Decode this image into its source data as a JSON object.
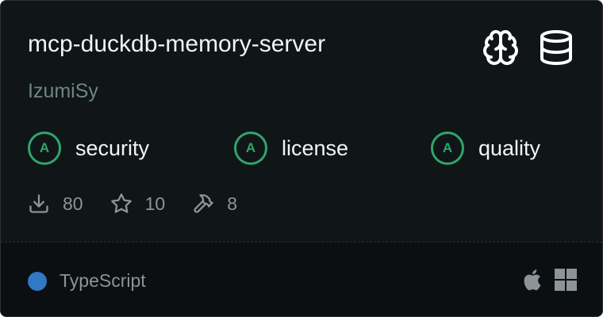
{
  "server": {
    "name": "mcp-duckdb-memory-server",
    "author": "IzumiSy"
  },
  "category_icons": [
    "brain-icon",
    "database-icon"
  ],
  "scores": [
    {
      "grade": "A",
      "label": "security"
    },
    {
      "grade": "A",
      "label": "license"
    },
    {
      "grade": "A",
      "label": "quality"
    }
  ],
  "stats": {
    "downloads": "80",
    "stars": "10",
    "tools": "8"
  },
  "language": {
    "name": "TypeScript",
    "color": "#3178c6"
  },
  "platform_icons": [
    "apple-icon",
    "windows-icon"
  ],
  "colors": {
    "grade_green": "#2fa56b",
    "background": "#101517"
  }
}
